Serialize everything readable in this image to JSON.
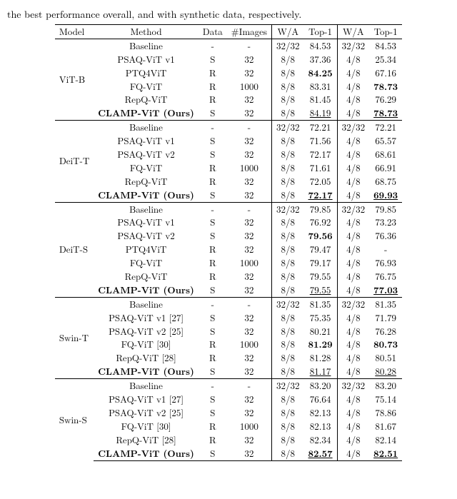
{
  "caption": "the best performance overall, and with synthetic data, respectively.",
  "chart_data": {
    "type": "table",
    "headers": [
      "Model",
      "Method",
      "Data",
      "#Images",
      "W/A",
      "Top-1",
      "W/A",
      "Top-1"
    ],
    "groups": [
      {
        "model": "ViT-B",
        "rows": [
          {
            "method": "Baseline",
            "bold": false,
            "data": "-",
            "images": "-",
            "wa1": "32/32",
            "t1": "84.53",
            "t1s": "",
            "wa2": "32/32",
            "t2": "84.53",
            "t2s": ""
          },
          {
            "method": "PSAQ-ViT v1",
            "bold": false,
            "data": "S",
            "images": "32",
            "wa1": "8/8",
            "t1": "37.36",
            "t1s": "",
            "wa2": "4/8",
            "t2": "25.34",
            "t2s": ""
          },
          {
            "method": "PTQ4ViT",
            "bold": false,
            "data": "R",
            "images": "32",
            "wa1": "8/8",
            "t1": "84.25",
            "t1s": "b",
            "wa2": "4/8",
            "t2": "67.16",
            "t2s": ""
          },
          {
            "method": "FQ-ViT",
            "bold": false,
            "data": "R",
            "images": "1000",
            "wa1": "8/8",
            "t1": "83.31",
            "t1s": "",
            "wa2": "4/8",
            "t2": "78.73",
            "t2s": "b"
          },
          {
            "method": "RepQ-ViT",
            "bold": false,
            "data": "R",
            "images": "32",
            "wa1": "8/8",
            "t1": "81.45",
            "t1s": "",
            "wa2": "4/8",
            "t2": "76.29",
            "t2s": ""
          },
          {
            "method": "CLAMP-ViT (Ours)",
            "bold": true,
            "data": "S",
            "images": "32",
            "wa1": "8/8",
            "t1": "84.19",
            "t1s": "u",
            "wa2": "4/8",
            "t2": "78.73",
            "t2s": "bu"
          }
        ]
      },
      {
        "model": "DeiT-T",
        "rows": [
          {
            "method": "Baseline",
            "bold": false,
            "data": "-",
            "images": "-",
            "wa1": "32/32",
            "t1": "72.21",
            "t1s": "",
            "wa2": "32/32",
            "t2": "72.21",
            "t2s": ""
          },
          {
            "method": "PSAQ-ViT v1",
            "bold": false,
            "data": "S",
            "images": "32",
            "wa1": "8/8",
            "t1": "71.56",
            "t1s": "",
            "wa2": "4/8",
            "t2": "65.57",
            "t2s": ""
          },
          {
            "method": "PSAQ-ViT v2",
            "bold": false,
            "data": "S",
            "images": "32",
            "wa1": "8/8",
            "t1": "72.17",
            "t1s": "",
            "wa2": "4/8",
            "t2": "68.61",
            "t2s": ""
          },
          {
            "method": "FQ-ViT",
            "bold": false,
            "data": "R",
            "images": "1000",
            "wa1": "8/8",
            "t1": "71.61",
            "t1s": "",
            "wa2": "4/8",
            "t2": "66.91",
            "t2s": ""
          },
          {
            "method": "RepQ-ViT",
            "bold": false,
            "data": "R",
            "images": "32",
            "wa1": "8/8",
            "t1": "72.05",
            "t1s": "",
            "wa2": "4/8",
            "t2": "68.75",
            "t2s": ""
          },
          {
            "method": "CLAMP-ViT (Ours)",
            "bold": true,
            "data": "S",
            "images": "32",
            "wa1": "8/8",
            "t1": "72.17",
            "t1s": "bu",
            "wa2": "4/8",
            "t2": "69.93",
            "t2s": "bu"
          }
        ]
      },
      {
        "model": "DeiT-S",
        "rows": [
          {
            "method": "Baseline",
            "bold": false,
            "data": "-",
            "images": "-",
            "wa1": "32/32",
            "t1": "79.85",
            "t1s": "",
            "wa2": "32/32",
            "t2": "79.85",
            "t2s": ""
          },
          {
            "method": "PSAQ-ViT v1",
            "bold": false,
            "data": "S",
            "images": "32",
            "wa1": "8/8",
            "t1": "76.92",
            "t1s": "",
            "wa2": "4/8",
            "t2": "73.23",
            "t2s": ""
          },
          {
            "method": "PSAQ-ViT v2",
            "bold": false,
            "data": "S",
            "images": "32",
            "wa1": "8/8",
            "t1": "79.56",
            "t1s": "b",
            "wa2": "4/8",
            "t2": "76.36",
            "t2s": ""
          },
          {
            "method": "PTQ4ViT",
            "bold": false,
            "data": "R",
            "images": "32",
            "wa1": "8/8",
            "t1": "79.47",
            "t1s": "",
            "wa2": "4/8",
            "t2": "-",
            "t2s": ""
          },
          {
            "method": "FQ-ViT",
            "bold": false,
            "data": "R",
            "images": "1000",
            "wa1": "8/8",
            "t1": "79.17",
            "t1s": "",
            "wa2": "4/8",
            "t2": "76.93",
            "t2s": ""
          },
          {
            "method": "RepQ-ViT",
            "bold": false,
            "data": "R",
            "images": "32",
            "wa1": "8/8",
            "t1": "79.55",
            "t1s": "",
            "wa2": "4/8",
            "t2": "76.75",
            "t2s": ""
          },
          {
            "method": "CLAMP-ViT (Ours)",
            "bold": true,
            "data": "S",
            "images": "32",
            "wa1": "8/8",
            "t1": "79.55",
            "t1s": "u",
            "wa2": "4/8",
            "t2": "77.03",
            "t2s": "bu"
          }
        ]
      },
      {
        "model": "Swin-T",
        "rows": [
          {
            "method": "Baseline",
            "bold": false,
            "data": "-",
            "images": "-",
            "wa1": "32/32",
            "t1": "81.35",
            "t1s": "",
            "wa2": "32/32",
            "t2": "81.35",
            "t2s": ""
          },
          {
            "method": "PSAQ-ViT v1 [27]",
            "bold": false,
            "data": "S",
            "images": "32",
            "wa1": "8/8",
            "t1": "75.35",
            "t1s": "",
            "wa2": "4/8",
            "t2": "71.79",
            "t2s": ""
          },
          {
            "method": "PSAQ-ViT v2 [25]",
            "bold": false,
            "data": "S",
            "images": "32",
            "wa1": "8/8",
            "t1": "80.21",
            "t1s": "",
            "wa2": "4/8",
            "t2": "76.28",
            "t2s": ""
          },
          {
            "method": "FQ-ViT [30]",
            "bold": false,
            "data": "R",
            "images": "1000",
            "wa1": "8/8",
            "t1": "81.29",
            "t1s": "b",
            "wa2": "4/8",
            "t2": "80.73",
            "t2s": "b"
          },
          {
            "method": "RepQ-ViT [28]",
            "bold": false,
            "data": "R",
            "images": "32",
            "wa1": "8/8",
            "t1": "81.28",
            "t1s": "",
            "wa2": "4/8",
            "t2": "80.51",
            "t2s": ""
          },
          {
            "method": "CLAMP-ViT (Ours)",
            "bold": true,
            "data": "S",
            "images": "32",
            "wa1": "8/8",
            "t1": "81.17",
            "t1s": "u",
            "wa2": "4/8",
            "t2": "80.28",
            "t2s": "u"
          }
        ]
      },
      {
        "model": "Swin-S",
        "rows": [
          {
            "method": "Baseline",
            "bold": false,
            "data": "-",
            "images": "-",
            "wa1": "32/32",
            "t1": "83.20",
            "t1s": "",
            "wa2": "32/32",
            "t2": "83.20",
            "t2s": ""
          },
          {
            "method": "PSAQ-ViT v1 [27]",
            "bold": false,
            "data": "S",
            "images": "32",
            "wa1": "8/8",
            "t1": "76.64",
            "t1s": "",
            "wa2": "4/8",
            "t2": "75.14",
            "t2s": ""
          },
          {
            "method": "PSAQ-ViT v2 [25]",
            "bold": false,
            "data": "S",
            "images": "32",
            "wa1": "8/8",
            "t1": "82.13",
            "t1s": "",
            "wa2": "4/8",
            "t2": "78.86",
            "t2s": ""
          },
          {
            "method": "FQ-ViT [30]",
            "bold": false,
            "data": "R",
            "images": "1000",
            "wa1": "8/8",
            "t1": "82.13",
            "t1s": "",
            "wa2": "4/8",
            "t2": "81.67",
            "t2s": ""
          },
          {
            "method": "RepQ-ViT [28]",
            "bold": false,
            "data": "R",
            "images": "32",
            "wa1": "8/8",
            "t1": "82.34",
            "t1s": "",
            "wa2": "4/8",
            "t2": "82.14",
            "t2s": ""
          },
          {
            "method": "CLAMP-ViT (Ours)",
            "bold": true,
            "data": "S",
            "images": "32",
            "wa1": "8/8",
            "t1": "82.57",
            "t1s": "bu",
            "wa2": "4/8",
            "t2": "82.51",
            "t2s": "bu"
          }
        ]
      }
    ]
  }
}
